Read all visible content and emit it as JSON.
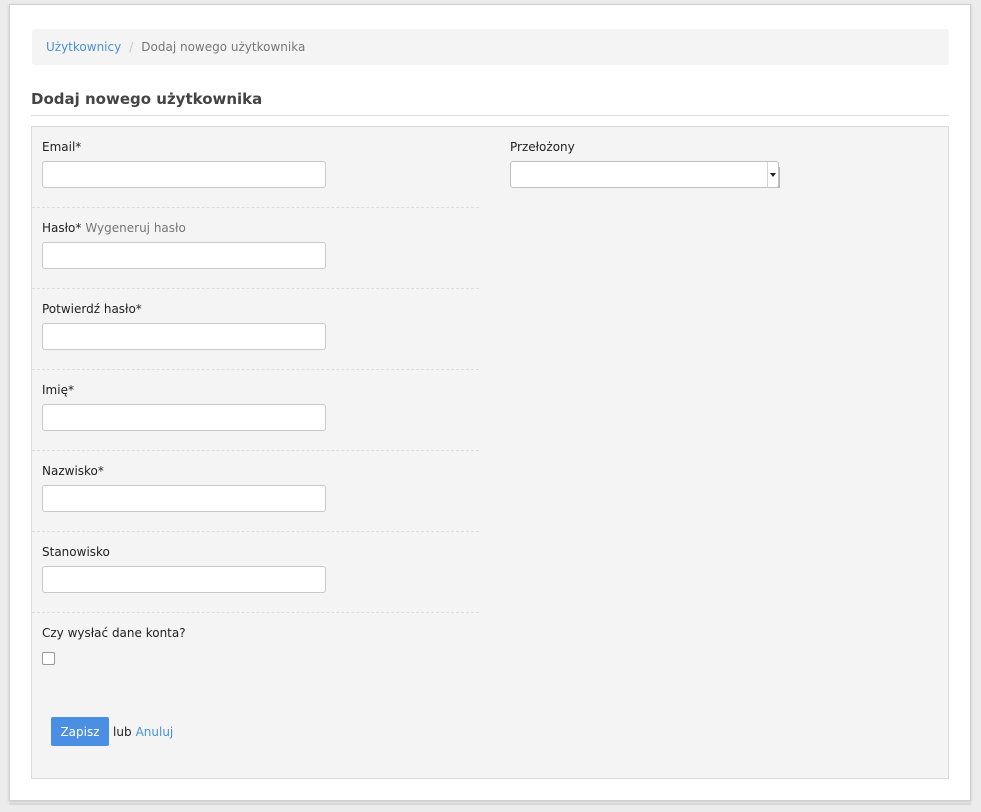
{
  "breadcrumb": {
    "items": [
      {
        "label": "Użytkownicy"
      },
      {
        "label": "Dodaj nowego użytkownika"
      }
    ],
    "separator": "/"
  },
  "page_title": "Dodaj nowego użytkownika",
  "form": {
    "email": {
      "label": "Email*",
      "value": ""
    },
    "password": {
      "label": "Hasło*",
      "hint": "Wygeneruj hasło",
      "value": ""
    },
    "confirm_password": {
      "label": "Potwierdź hasło*",
      "value": ""
    },
    "first_name": {
      "label": "Imię*",
      "value": ""
    },
    "last_name": {
      "label": "Nazwisko*",
      "value": ""
    },
    "position": {
      "label": "Stanowisko",
      "value": ""
    },
    "send_account_data": {
      "label": "Czy wysłać dane konta?",
      "checked": false
    },
    "superior": {
      "label": "Przełożony",
      "selected": ""
    }
  },
  "actions": {
    "save_label": "Zapisz",
    "or_label": "lub",
    "cancel_label": "Anuluj"
  },
  "colors": {
    "accent": "#4a8fe3",
    "link": "#4a90d9",
    "panel": "#f4f4f4"
  }
}
